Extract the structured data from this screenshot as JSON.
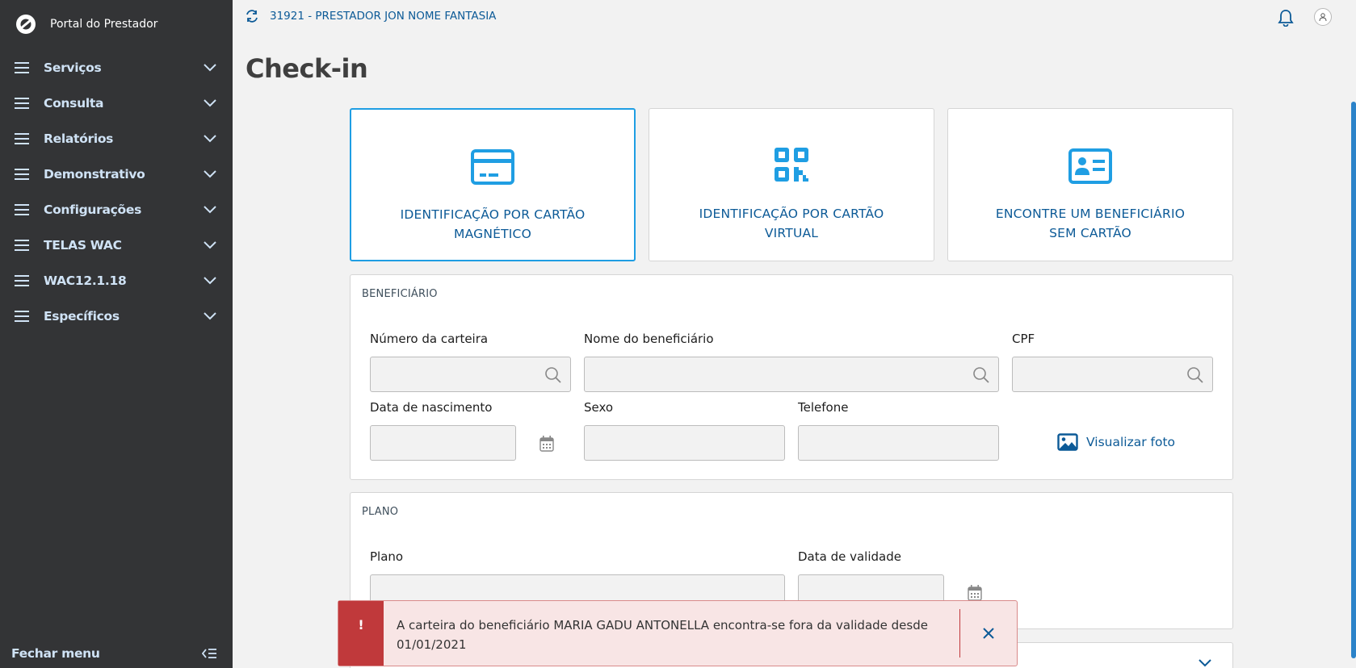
{
  "sidebar": {
    "title": "Portal do Prestador",
    "items": [
      {
        "label": "Serviços"
      },
      {
        "label": "Consulta"
      },
      {
        "label": "Relatórios"
      },
      {
        "label": "Demonstrativo"
      },
      {
        "label": "Configurações"
      },
      {
        "label": "TELAS WAC"
      },
      {
        "label": "WAC12.1.18"
      },
      {
        "label": "Específicos"
      }
    ],
    "footer_label": "Fechar menu"
  },
  "topbar": {
    "provider": "31921 - PRESTADOR JON NOME FANTASIA"
  },
  "page": {
    "title": "Check-in"
  },
  "cards": [
    {
      "label": "IDENTIFICAÇÃO POR CARTÃO MAGNÉTICO",
      "icon": "credit-card-icon"
    },
    {
      "label": "IDENTIFICAÇÃO POR CARTÃO VIRTUAL",
      "icon": "qr-code-icon"
    },
    {
      "label": "ENCONTRE UM BENEFICIÁRIO SEM CARTÃO",
      "icon": "id-card-icon"
    }
  ],
  "beneficiario": {
    "title": "BENEFICIÁRIO",
    "numero_carteira_label": "Número da carteira",
    "nome_label": "Nome do beneficiário",
    "cpf_label": "CPF",
    "nascimento_label": "Data de nascimento",
    "sexo_label": "Sexo",
    "telefone_label": "Telefone",
    "foto_label": "Visualizar foto",
    "numero_carteira_value": "",
    "nome_value": "",
    "cpf_value": "",
    "nascimento_value": "",
    "sexo_value": "",
    "telefone_value": ""
  },
  "plano": {
    "title": "PLANO",
    "plano_label": "Plano",
    "validade_label": "Data de validade",
    "plano_value": "",
    "validade_value": ""
  },
  "toast": {
    "icon": "!",
    "message": "A carteira do beneficiário MARIA GADU ANTONELLA encontra-se fora da validade desde 01/01/2021"
  },
  "colors": {
    "sidebar_bg": "#333436",
    "accent": "#1f9ee3",
    "link": "#0c5a97",
    "danger": "#c0393b"
  }
}
